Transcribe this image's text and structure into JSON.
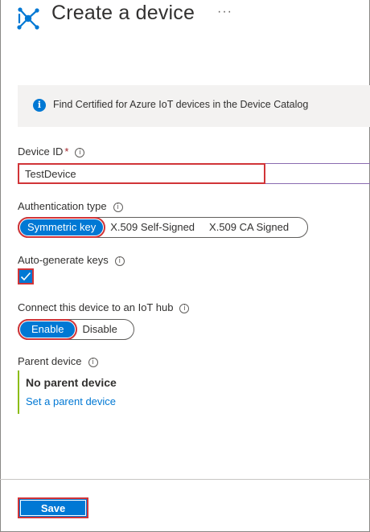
{
  "header": {
    "title": "Create a device",
    "more": "···",
    "logo_icon": "iot-device-icon"
  },
  "info": {
    "icon": "info-icon",
    "text": "Find Certified for Azure IoT devices in the Device Catalog"
  },
  "device_id": {
    "label": "Device ID",
    "required_mark": "*",
    "value": "TestDevice"
  },
  "auth": {
    "label": "Authentication type",
    "options": [
      "Symmetric key",
      "X.509 Self-Signed",
      "X.509 CA Signed"
    ],
    "selected": "Symmetric key"
  },
  "autogen": {
    "label": "Auto-generate keys",
    "checked": true
  },
  "connect": {
    "label": "Connect this device to an IoT hub",
    "options": [
      "Enable",
      "Disable"
    ],
    "selected": "Enable"
  },
  "parent": {
    "label": "Parent device",
    "value": "No parent device",
    "link": "Set a parent device"
  },
  "footer": {
    "save_label": "Save"
  },
  "colors": {
    "accent": "#0078d4",
    "highlight": "#d13438",
    "parent_bar": "#8cbd18"
  }
}
